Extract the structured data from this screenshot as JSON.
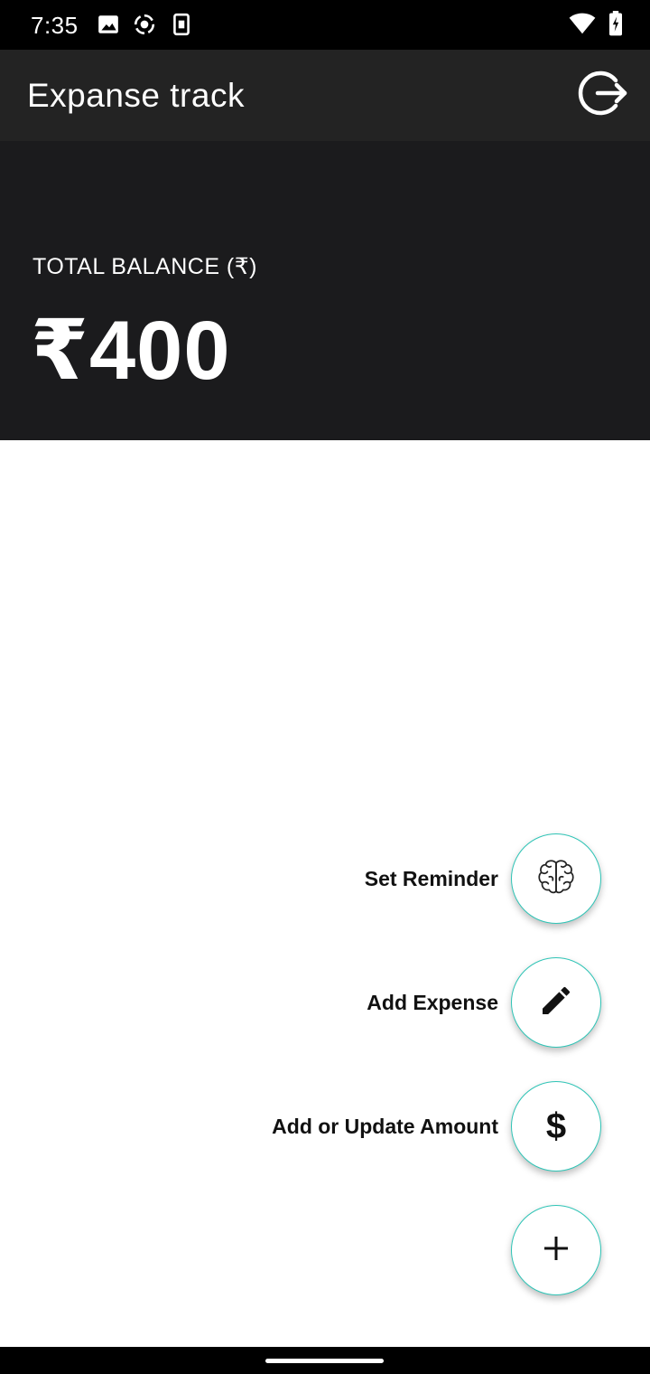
{
  "status_bar": {
    "time": "7:35",
    "left_icons": [
      "image-icon",
      "sync-icon",
      "sim-card-icon"
    ],
    "right_icons": [
      "wifi-icon",
      "battery-charging-icon"
    ]
  },
  "app_bar": {
    "title": "Expanse track",
    "logout_icon": "logout-icon"
  },
  "balance": {
    "label": "TOTAL BALANCE (₹)",
    "amount": "₹400"
  },
  "fab_menu": {
    "items": [
      {
        "label": "Set Reminder",
        "icon": "brain-icon"
      },
      {
        "label": "Add Expense",
        "icon": "pencil-icon"
      },
      {
        "label": "Add or Update Amount",
        "icon": "dollar-icon",
        "symbol": "$"
      }
    ],
    "main_symbol": "+",
    "main_icon": "plus-icon"
  },
  "colors": {
    "accent": "#2ec4b6",
    "app_bar": "#232323",
    "balance_card": "#1b1b1d"
  }
}
